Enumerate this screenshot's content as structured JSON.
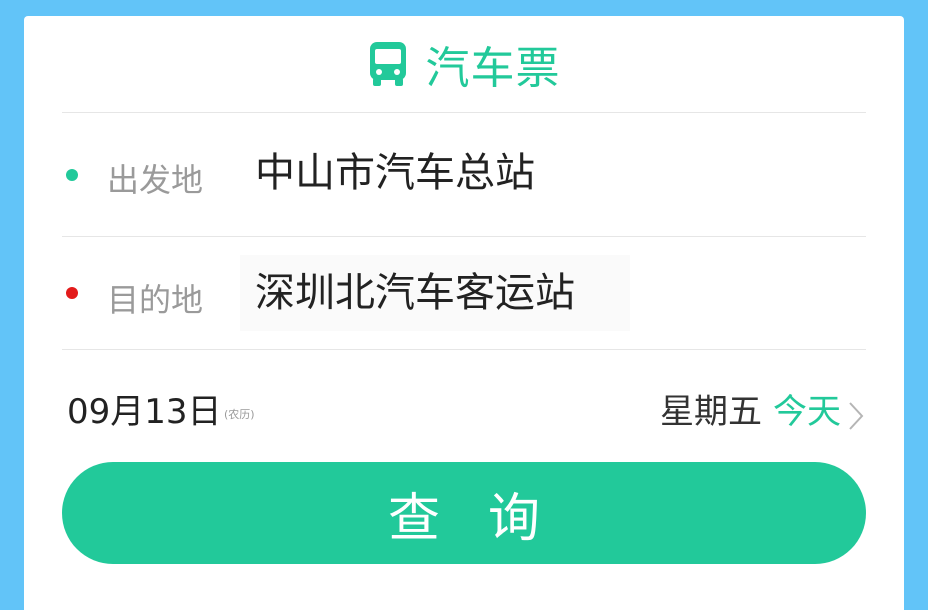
{
  "header": {
    "icon": "bus-icon",
    "title": "汽车票"
  },
  "origin": {
    "label": "出发地",
    "value": "中山市汽车总站",
    "dot_color": "#22c99a"
  },
  "destination": {
    "label": "目的地",
    "value": "深圳北汽车客运站",
    "dot_color": "#e31b1b"
  },
  "date": {
    "date_text": "09月13日",
    "lunar_label": "(农历)",
    "weekday": "星期五",
    "today_label": "今天",
    "chevron_icon": "chevron-right-icon"
  },
  "actions": {
    "search_label": "查询"
  },
  "colors": {
    "accent": "#22c99a",
    "background": "#62c4f8",
    "destination_dot": "#e31b1b"
  }
}
